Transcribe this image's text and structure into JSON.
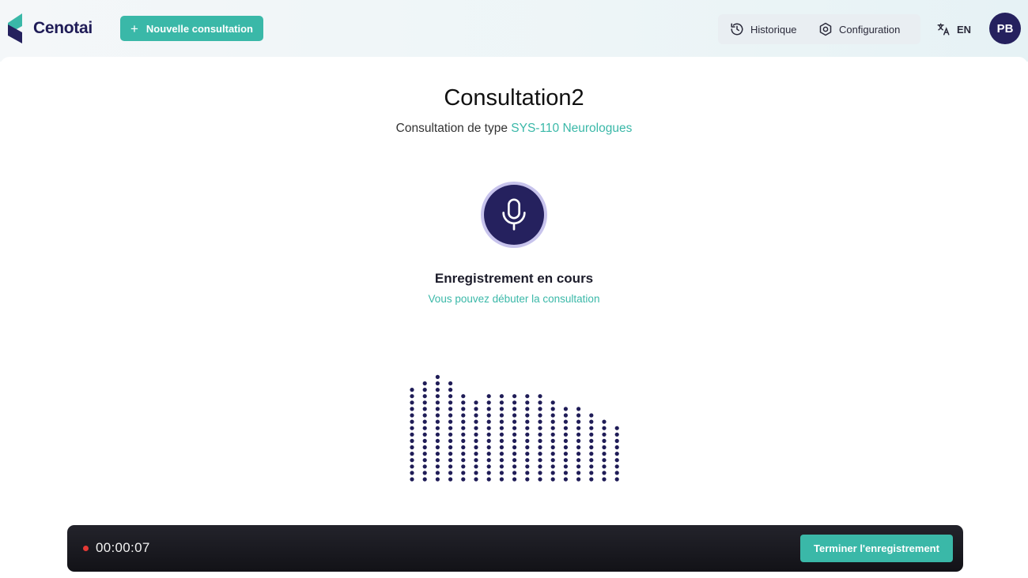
{
  "header": {
    "brand": "Cenotai",
    "new_consultation_label": "Nouvelle consultation",
    "nav": [
      {
        "label": "Historique",
        "icon": "history-icon"
      },
      {
        "label": "Configuration",
        "icon": "gear-icon"
      }
    ],
    "language": {
      "label": "EN",
      "icon": "translate-icon"
    },
    "user_initials": "PB"
  },
  "main": {
    "title": "Consultation2",
    "subtitle_prefix": "Consultation de type ",
    "subtitle_type": "SYS-110 Neurologues",
    "status_title": "Enregistrement en cours",
    "status_subtitle": "Vous pouvez débuter la consultation"
  },
  "waveform": {
    "dot_color": "#1f1c57",
    "levels": [
      15,
      16,
      17,
      16,
      14,
      13,
      14,
      14,
      14,
      14,
      14,
      13,
      12,
      12,
      11,
      10,
      9
    ]
  },
  "recorder": {
    "elapsed": "00:00:07",
    "stop_label": "Terminer l'enregistrement"
  },
  "colors": {
    "accent": "#3ab8a8",
    "brand_dark": "#25215e",
    "record_dot": "#e53935"
  }
}
